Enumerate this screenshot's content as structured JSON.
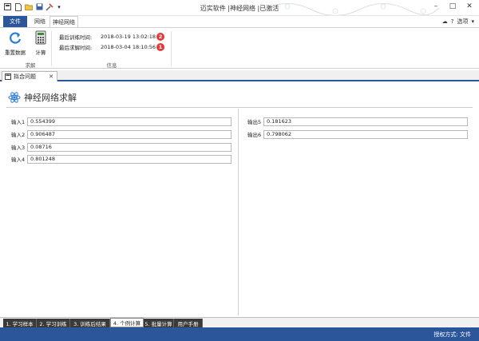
{
  "window": {
    "title": "迈实软件 |神经网络 |已激活",
    "minimize": "–",
    "maximize": "□",
    "close": "✕"
  },
  "ribbon": {
    "tabs": {
      "file": "文件",
      "network": "网络",
      "neural": "神经网络"
    },
    "right_tools": {
      "options": "选项"
    },
    "buttons": {
      "reload": "重置数据",
      "compute": "计算"
    },
    "groups": {
      "solve": "求解",
      "info": "信息"
    },
    "info": {
      "last_train_label": "最后训练时间:",
      "last_train_value": "2018-03-19 13:02:18",
      "last_train_badge": "2",
      "last_solve_label": "最后求解时间:",
      "last_solve_value": "2018-03-04 18:10:56",
      "last_solve_badge": "1"
    }
  },
  "doc_tab": {
    "label": "拟合问题",
    "close": "✕"
  },
  "page": {
    "title": "神经网络求解",
    "inputs": [
      {
        "label": "输入1",
        "value": "0.554399"
      },
      {
        "label": "输入2",
        "value": "0.906487"
      },
      {
        "label": "输入3",
        "value": "0.08716"
      },
      {
        "label": "输入4",
        "value": "0.801248"
      }
    ],
    "outputs": [
      {
        "label": "输出5",
        "value": "0.181623"
      },
      {
        "label": "输出6",
        "value": "0.798062"
      }
    ]
  },
  "bottom_tabs": [
    "1. 学习样本",
    "2. 学习训练",
    "3. 训练后结果",
    "4. 个例计算",
    "5. 批量计算",
    "用户手册"
  ],
  "status": {
    "text": "授权方式: 文件"
  },
  "colors": {
    "accent": "#2b579a",
    "badge": "#e03a3a"
  }
}
